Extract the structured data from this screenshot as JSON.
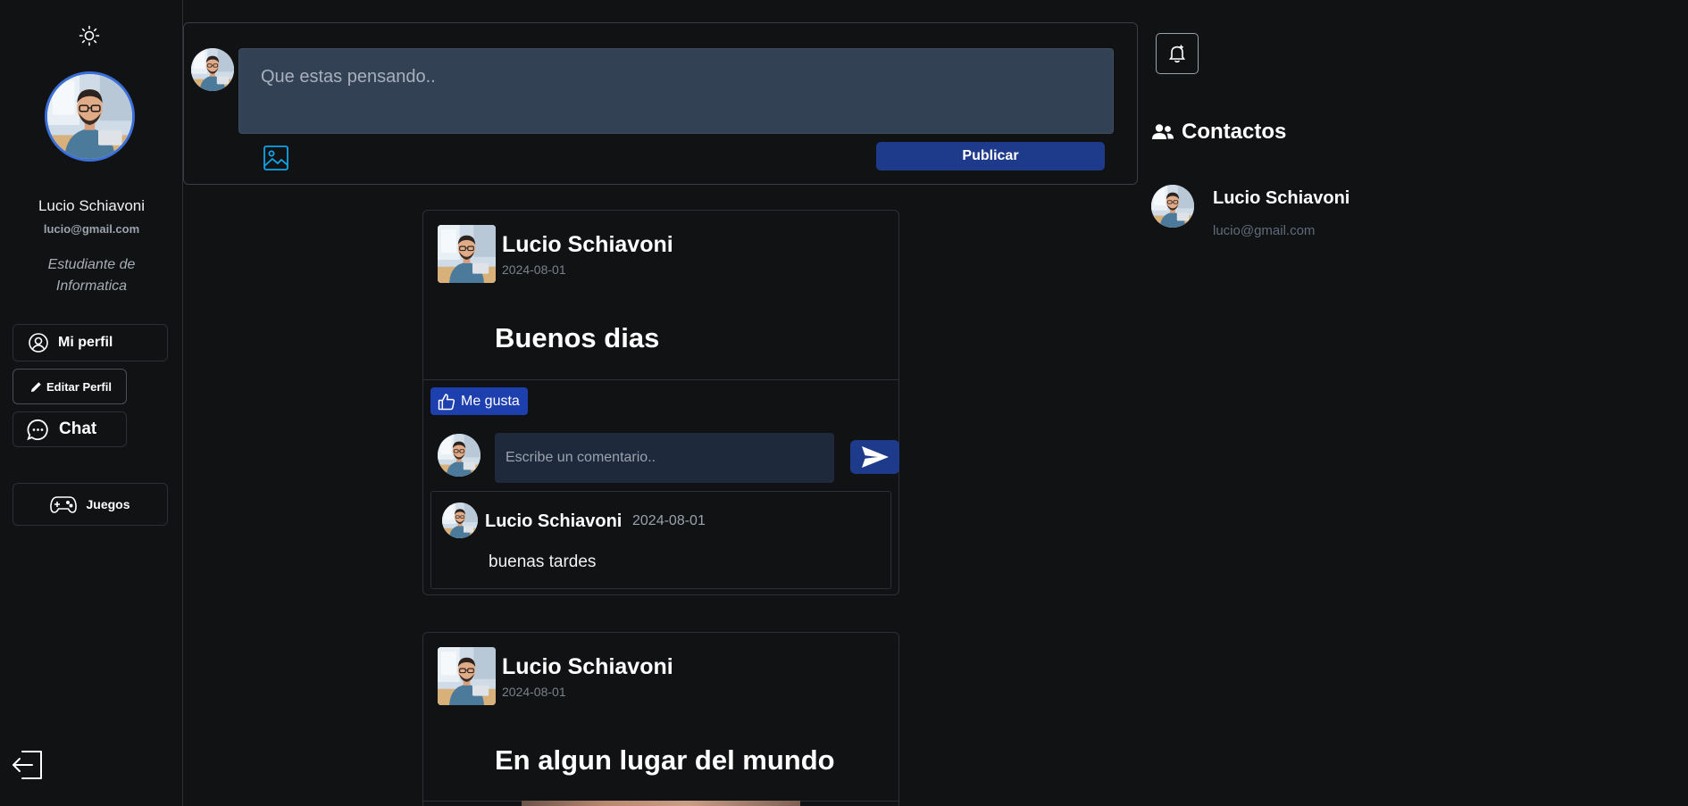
{
  "sidebar": {
    "theme_icon": "sun-icon",
    "user": {
      "name": "Lucio Schiavoni",
      "email": "lucio@gmail.com",
      "bio": "Estudiante de Informatica"
    },
    "nav": {
      "profile_label": "Mi perfil",
      "edit_label": "Editar Perfil",
      "chat_label": "Chat",
      "games_label": "Juegos"
    },
    "logout_icon": "logout-icon"
  },
  "composer": {
    "placeholder": "Que estas pensando..",
    "publish_label": "Publicar"
  },
  "right": {
    "contacts_title": "Contactos",
    "contacts": [
      {
        "name": "Lucio Schiavoni",
        "email": "lucio@gmail.com"
      }
    ]
  },
  "posts": [
    {
      "author": "Lucio Schiavoni",
      "date": "2024-08-01",
      "text": "Buenos dias",
      "like_label": "Me gusta",
      "comment_placeholder": "Escribe un comentario..",
      "comments": [
        {
          "author": "Lucio Schiavoni",
          "date": "2024-08-01",
          "text": "buenas tardes"
        }
      ]
    },
    {
      "author": "Lucio Schiavoni",
      "date": "2024-08-01",
      "text": "En algun lugar del mundo"
    }
  ],
  "colors": {
    "background": "#111214",
    "accent": "#1e3a8a",
    "like": "#1e40af",
    "composer_input": "#334155",
    "comment_input": "#1e293b",
    "avatar_ring": "#3b6fd8"
  }
}
